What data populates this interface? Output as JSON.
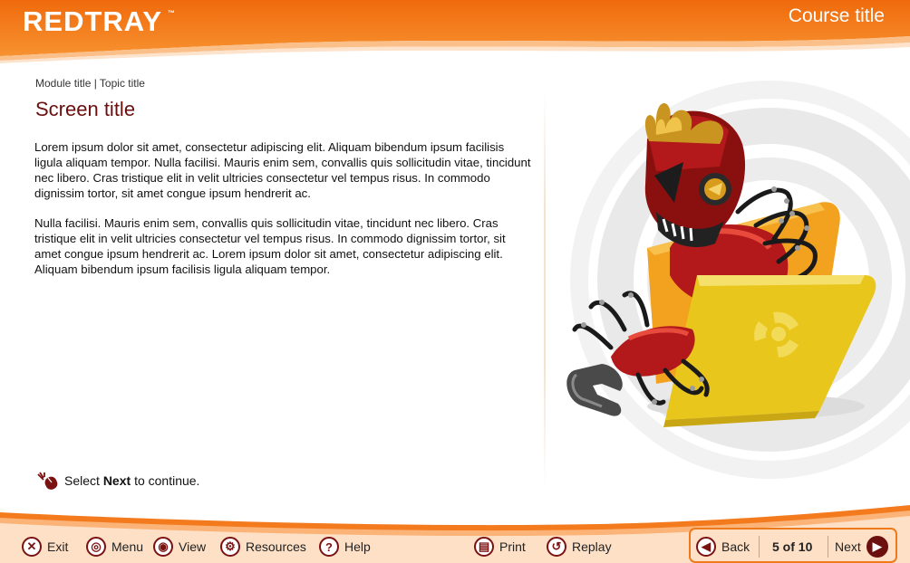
{
  "header": {
    "logo": "REDTRAY",
    "trademark": "™",
    "course_title": "Course title"
  },
  "content": {
    "breadcrumb": "Module title | Topic title",
    "screen_title": "Screen title",
    "paragraphs": [
      "Lorem ipsum dolor sit amet, consectetur adipiscing elit. Aliquam bibendum ipsum facilisis ligula aliquam tempor. Nulla facilisi. Mauris enim sem, convallis quis sollicitudin vitae, tincidunt nec libero. Cras tristique elit in velit ultricies consectetur vel tempus risus. In commodo dignissim tortor, sit amet congue ipsum hendrerit ac.",
      "Nulla facilisi. Mauris enim sem, convallis quis sollicitudin vitae, tincidunt nec libero. Cras tristique elit in velit ultricies consectetur vel tempus risus. In commodo dignissim tortor, sit amet congue ipsum hendrerit ac. Lorem ipsum dolor sit amet, consectetur adipiscing elit. Aliquam bibendum ipsum facilisis ligula aliquam tempor."
    ],
    "instruction_prefix": "Select ",
    "instruction_bold": "Next",
    "instruction_suffix": " to continue."
  },
  "footer": {
    "exit": "Exit",
    "menu": "Menu",
    "view": "View",
    "resources": "Resources",
    "help": "Help",
    "print": "Print",
    "replay": "Replay",
    "back": "Back",
    "page_indicator": "5 of 10",
    "next": "Next"
  },
  "colors": {
    "brand_orange": "#f47a1e",
    "title_red": "#6b0f0f",
    "icon_red": "#7b1212"
  },
  "icons": [
    "close-icon",
    "target-icon",
    "eye-icon",
    "gear-icon",
    "question-icon",
    "printer-icon",
    "replay-icon",
    "arrow-left-icon",
    "arrow-right-icon",
    "mouse-click-icon"
  ]
}
